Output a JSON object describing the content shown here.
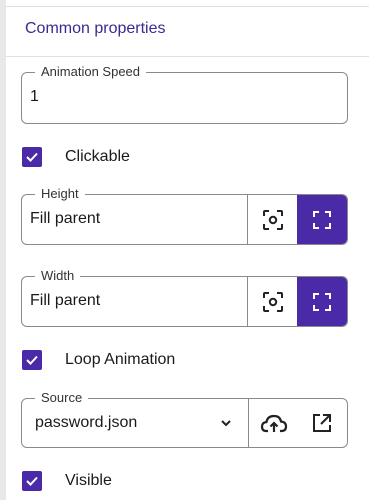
{
  "section": {
    "title": "Common properties"
  },
  "animation_speed": {
    "label": "Animation Speed",
    "value": "1"
  },
  "clickable": {
    "label": "Clickable",
    "checked": true
  },
  "height": {
    "label": "Height",
    "value": "Fill parent",
    "fit_icon": "focus-frame-icon",
    "fill_icon": "expand-corners-icon",
    "active": "fill"
  },
  "width": {
    "label": "Width",
    "value": "Fill parent",
    "fit_icon": "focus-frame-icon",
    "fill_icon": "expand-corners-icon",
    "active": "fill"
  },
  "loop_animation": {
    "label": "Loop Animation",
    "checked": true
  },
  "source": {
    "label": "Source",
    "value": "password.json",
    "upload_icon": "cloud-upload-icon",
    "open_icon": "open-external-icon"
  },
  "visible": {
    "label": "Visible",
    "checked": true
  },
  "colors": {
    "accent": "#4a2aa6",
    "title": "#3b2a8f",
    "border": "#8a8a8a"
  }
}
